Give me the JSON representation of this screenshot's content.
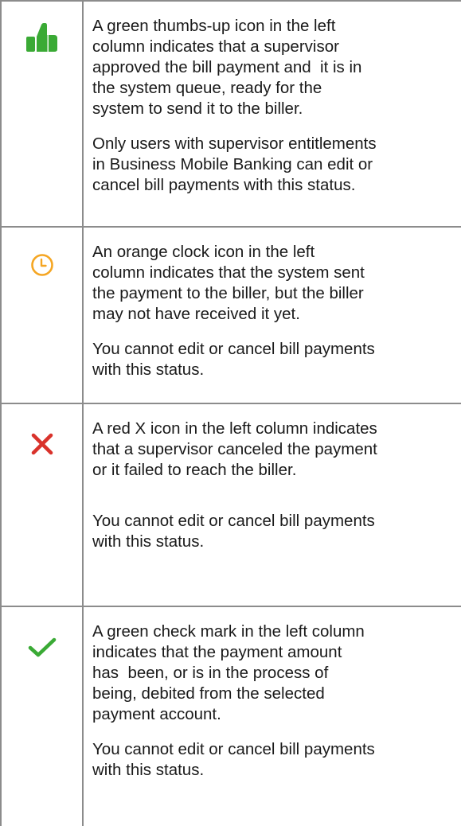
{
  "colors": {
    "approved_green": "#3aaa35",
    "clock_orange": "#f5a623",
    "cancel_red": "#d9322b",
    "check_green": "#3aaa35",
    "border": "#8c8c8c"
  },
  "rows": [
    {
      "icon": "thumbs-up-icon",
      "paragraphs": [
        "A green thumbs-up icon in the left\ncolumn indicates that a supervisor\napproved the bill payment and  it is in\nthe system queue, ready for the\nsystem to send it to the biller.",
        "Only users with supervisor entitlements\nin Business Mobile Banking can edit or\ncancel bill payments with this status."
      ]
    },
    {
      "icon": "clock-icon",
      "paragraphs": [
        "An orange clock icon in the left\ncolumn indicates that the system sent\nthe payment to the biller, but the biller\nmay not have received it yet.",
        "You cannot edit or cancel bill payments\nwith this status."
      ]
    },
    {
      "icon": "x-icon",
      "paragraphs": [
        "A red X icon in the left column indicates\nthat a supervisor canceled the payment\nor it failed to reach the biller.",
        "You cannot edit or cancel bill payments\nwith this status."
      ]
    },
    {
      "icon": "check-mark-icon",
      "paragraphs": [
        "A green check mark in the left column\nindicates that the payment amount\nhas  been, or is in the process of\nbeing, debited from the selected\npayment account.",
        "You cannot edit or cancel bill payments\nwith this status."
      ]
    }
  ]
}
